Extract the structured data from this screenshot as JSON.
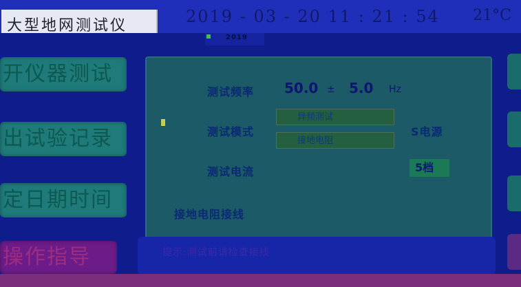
{
  "header": {
    "title": "大型地网测试仪",
    "datetime": "2019 - 03 - 20   11 : 21 : 54",
    "temperature": "21°C",
    "sub_indicator": "2019"
  },
  "sidebar": {
    "buttons": [
      {
        "label": "开仪器测试"
      },
      {
        "label": "出试验记录"
      },
      {
        "label": "定日期时间"
      },
      {
        "label": "操作指导"
      }
    ]
  },
  "panel": {
    "freq_label": "测试频率",
    "freq_value_1": "50.0",
    "freq_sep": "±",
    "freq_value_2": "5.0",
    "freq_unit": "Hz",
    "mode_label": "测试模式",
    "mode_option_1": "异频测试",
    "mode_option_2": "接地电阻",
    "power_label": "电源",
    "power_prefix": "S电源",
    "current_label": "测试电流",
    "current_value": "5档",
    "wiring_label": "接地电阻接线"
  },
  "bottom_bar": {
    "text": "提示:测试前请检查接线"
  },
  "colors": {
    "background": "#0f1c8c",
    "header": "#1f2fb9",
    "panel": "#1b5a66",
    "side_button": "#1f7a7a"
  }
}
